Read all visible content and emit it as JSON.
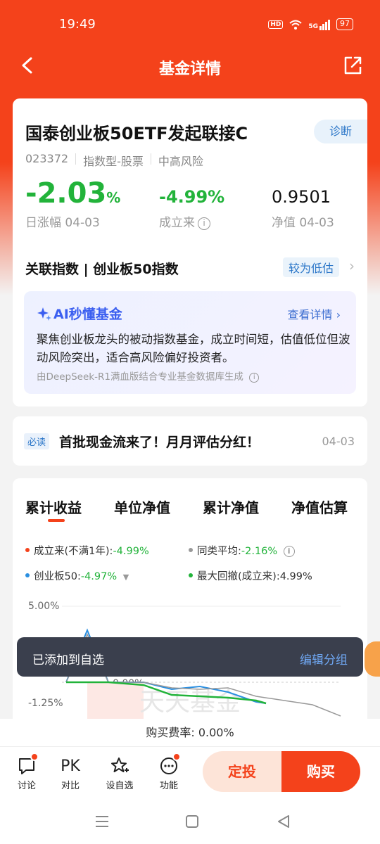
{
  "status_bar": {
    "time": "19:49",
    "hd": "HD",
    "signal": "5G",
    "battery": "97"
  },
  "header": {
    "title": "基金详情"
  },
  "fund": {
    "name": "国泰创业板50ETF发起联接C",
    "diagnose_label": "诊断",
    "code": "023372",
    "type": "指数型-股票",
    "risk": "中高风险",
    "daily_change": "-2.03",
    "daily_change_unit": "%",
    "daily_change_label": "日涨幅 04-03",
    "since_inception": "-4.99%",
    "since_inception_label": "成立来",
    "nav": "0.9501",
    "nav_label": "净值 04-03",
    "related_index_label": "关联指数 | 创业板50指数",
    "valuation_tag": "较为低估"
  },
  "ai": {
    "title": "AI秒懂基金",
    "more": "查看详情",
    "text": "聚焦创业板龙头的被动指数基金，成立时间短，估值低位但波动风险突出，适合高风险偏好投资者。",
    "source": "由DeepSeek-R1满血版结合专业基金数据库生成"
  },
  "news": {
    "badge": "必读",
    "title": "首批现金流来了！月月评估分红！",
    "date": "04-03"
  },
  "tabs": [
    "累计收益",
    "单位净值",
    "累计净值",
    "净值估算"
  ],
  "legend": {
    "since": {
      "label": "成立来(不满1年):",
      "value": "-4.99%",
      "color": "#f4421b"
    },
    "peer": {
      "label": "同类平均:",
      "value": "-2.16%",
      "color": "#999999"
    },
    "index": {
      "label": "创业板50:",
      "value": "-4.97%",
      "color": "#2b8fe0"
    },
    "drawdown": {
      "label": "最大回撤(成立来):",
      "value": "4.99%",
      "color": "#22b33a"
    }
  },
  "chart": {
    "ytick_top": "5.00%",
    "ytick_mid": "0.00%",
    "ytick_low": "-1.25%",
    "watermark": "天天基金"
  },
  "toast": {
    "message": "已添加到自选",
    "action": "编辑分组"
  },
  "fee": {
    "text": "购买费率: 0.00%"
  },
  "bottom": {
    "discuss": "讨论",
    "compare_icon": "PK",
    "compare": "对比",
    "watch": "设自选",
    "functions": "功能",
    "auto_invest": "定投",
    "buy": "购买"
  }
}
